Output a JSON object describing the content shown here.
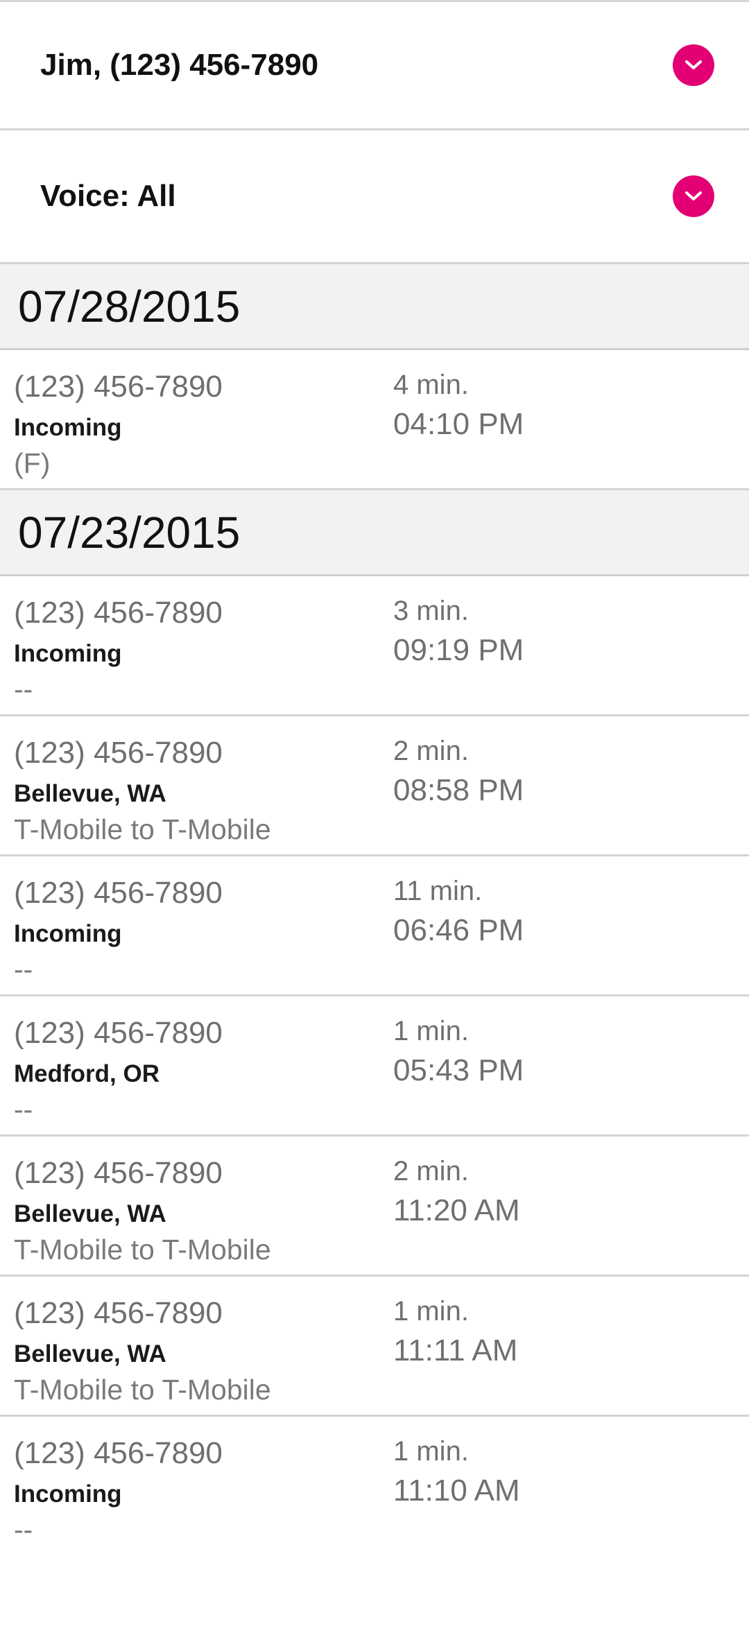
{
  "filters": {
    "line": {
      "label": "Jim, (123) 456-7890",
      "icon": "chevron-down-icon"
    },
    "voice": {
      "label": "Voice: All",
      "icon": "chevron-down-icon"
    }
  },
  "colors": {
    "accent": "#e20074",
    "date_header_bg": "#f2f2f2",
    "divider": "#d3d3d3",
    "secondary_text": "#6f6f6f"
  },
  "groups": [
    {
      "date": "07/28/2015",
      "calls": [
        {
          "number": "(123) 456-7890",
          "type": "Incoming",
          "note": "(F)",
          "duration": "4 min.",
          "time": "04:10 PM"
        }
      ]
    },
    {
      "date": "07/23/2015",
      "calls": [
        {
          "number": "(123) 456-7890",
          "type": "Incoming",
          "note": "--",
          "duration": "3 min.",
          "time": "09:19 PM"
        },
        {
          "number": "(123) 456-7890",
          "type": "Bellevue, WA",
          "note": "T-Mobile to T-Mobile",
          "duration": "2 min.",
          "time": "08:58 PM"
        },
        {
          "number": "(123) 456-7890",
          "type": "Incoming",
          "note": "--",
          "duration": "11 min.",
          "time": "06:46 PM"
        },
        {
          "number": "(123) 456-7890",
          "type": "Medford, OR",
          "note": "--",
          "duration": "1 min.",
          "time": "05:43 PM"
        },
        {
          "number": "(123) 456-7890",
          "type": "Bellevue, WA",
          "note": "T-Mobile to T-Mobile",
          "duration": "2 min.",
          "time": "11:20 AM"
        },
        {
          "number": "(123) 456-7890",
          "type": "Bellevue, WA",
          "note": "T-Mobile to T-Mobile",
          "duration": "1 min.",
          "time": "11:11 AM"
        },
        {
          "number": "(123) 456-7890",
          "type": "Incoming",
          "note": "--",
          "duration": "1 min.",
          "time": "11:10 AM"
        }
      ]
    }
  ]
}
